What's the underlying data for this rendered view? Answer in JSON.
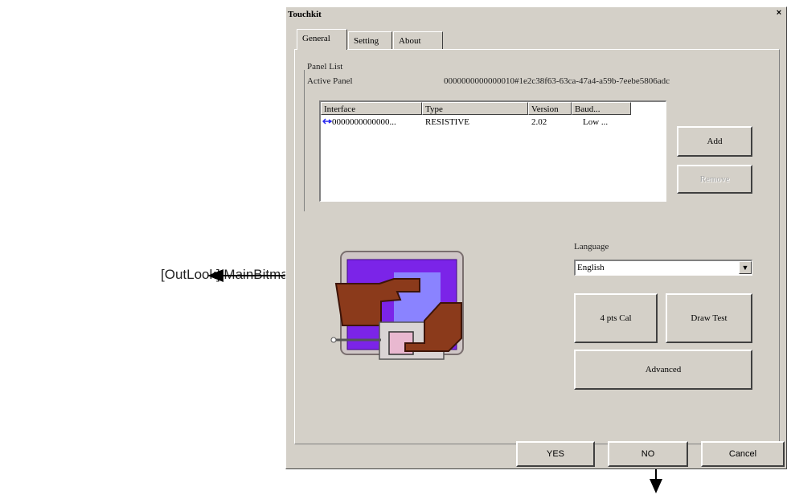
{
  "annotation": {
    "left_label": "[OutLook] MainBitmap"
  },
  "window": {
    "title": "Touchkit",
    "close_glyph": "×"
  },
  "tabs": [
    {
      "label": "General",
      "active": true
    },
    {
      "label": "Setting",
      "active": false
    },
    {
      "label": "About",
      "active": false
    }
  ],
  "panel": {
    "group_label": "Panel List",
    "active_panel_label": "Active Panel",
    "active_panel_value": "0000000000000010#1e2c38f63-63ca-47a4-a59b-7eebe5806adc"
  },
  "listview": {
    "columns": [
      "Interface",
      "Type",
      "Version",
      "Baud..."
    ],
    "rows": [
      {
        "interface": "0000000000000...",
        "type": "RESISTIVE",
        "version": "2.02",
        "baud": "Low ..."
      }
    ]
  },
  "buttons": {
    "add": "Add",
    "remove": "Remove",
    "cal": "4 pts Cal",
    "draw_test": "Draw Test",
    "advanced": "Advanced",
    "yes": "YES",
    "no": "NO",
    "cancel": "Cancel"
  },
  "language": {
    "label": "Language",
    "selected": "English"
  },
  "icons": {
    "usb": "usb-icon",
    "dropdown": "chevron-down-icon",
    "main_bitmap": "touch-panel-hands-icon"
  }
}
